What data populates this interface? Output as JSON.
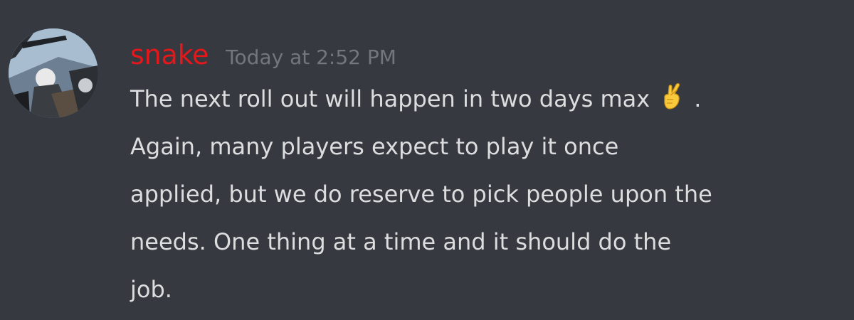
{
  "message": {
    "author": "snake",
    "timestamp": "Today at 2:52 PM",
    "lines": [
      "The next roll out will happen in two days max",
      ".",
      "Again, many players expect to play it once",
      "applied, but we do reserve to pick people upon the",
      "needs. One thing at a time and it should do the",
      "job."
    ],
    "emoji": "crossed-fingers-icon"
  },
  "colors": {
    "background": "#36393f",
    "username": "#e6171b",
    "timestamp": "#72767d",
    "text": "#dcddde"
  }
}
